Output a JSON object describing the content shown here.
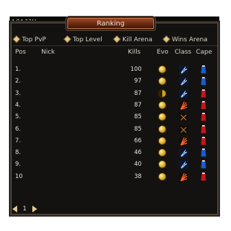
{
  "window": {
    "title": "Ranking",
    "background_text": "4 94 11H"
  },
  "tabs": [
    {
      "label": "Top PvP"
    },
    {
      "label": "Top Level"
    },
    {
      "label": "Kill Arena"
    },
    {
      "label": "Wins Arena"
    }
  ],
  "columns": {
    "pos": "Pos",
    "nick": "Nick",
    "kills": "Kills",
    "evo": "Evo",
    "class": "Class",
    "cape": "Cape"
  },
  "rows": [
    {
      "pos": "1.",
      "nick": "",
      "kills": "100",
      "evo": "full",
      "class": "lightning-icon",
      "cape": "blue"
    },
    {
      "pos": "2.",
      "nick": "",
      "kills": "97",
      "evo": "full",
      "class": "lightning-icon",
      "cape": "blue"
    },
    {
      "pos": "3.",
      "nick": "",
      "kills": "87",
      "evo": "half",
      "class": "lightning-icon",
      "cape": "red"
    },
    {
      "pos": "4.",
      "nick": "",
      "kills": "87",
      "evo": "full",
      "class": "fan-icon",
      "cape": "red"
    },
    {
      "pos": "5.",
      "nick": "",
      "kills": "85",
      "evo": "full",
      "class": "swords-icon",
      "cape": "red"
    },
    {
      "pos": "6.",
      "nick": "",
      "kills": "85",
      "evo": "full",
      "class": "swords-icon",
      "cape": "red"
    },
    {
      "pos": "7.",
      "nick": "",
      "kills": "66",
      "evo": "full",
      "class": "fan-icon",
      "cape": "red"
    },
    {
      "pos": "8.",
      "nick": "",
      "kills": "46",
      "evo": "full",
      "class": "lightning-icon",
      "cape": "blue"
    },
    {
      "pos": "9.",
      "nick": "",
      "kills": "40",
      "evo": "full",
      "class": "lightning-icon",
      "cape": "blue"
    },
    {
      "pos": "10",
      "nick": "",
      "kills": "38",
      "evo": "full",
      "class": "fan-icon",
      "cape": "red"
    }
  ],
  "pager": {
    "page": "1"
  },
  "colors": {
    "cape_blue": "#1b5cc8",
    "cape_red": "#c0181c",
    "lightning": "#2f8cff",
    "fan": "#ff6a2a",
    "swords": "#b07a4a"
  }
}
